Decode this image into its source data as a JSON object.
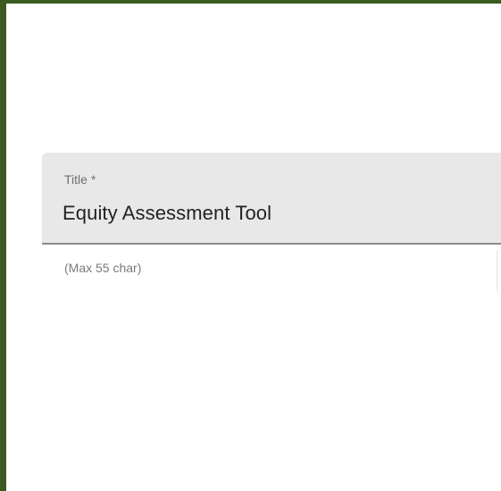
{
  "form": {
    "title_field": {
      "label": "Title *",
      "value": "Equity Assessment Tool",
      "hint": "(Max 55 char)"
    }
  },
  "colors": {
    "frame_border": "#3b5a1f",
    "field_background": "#e8e8e8",
    "field_underline": "#8a8a8a"
  }
}
